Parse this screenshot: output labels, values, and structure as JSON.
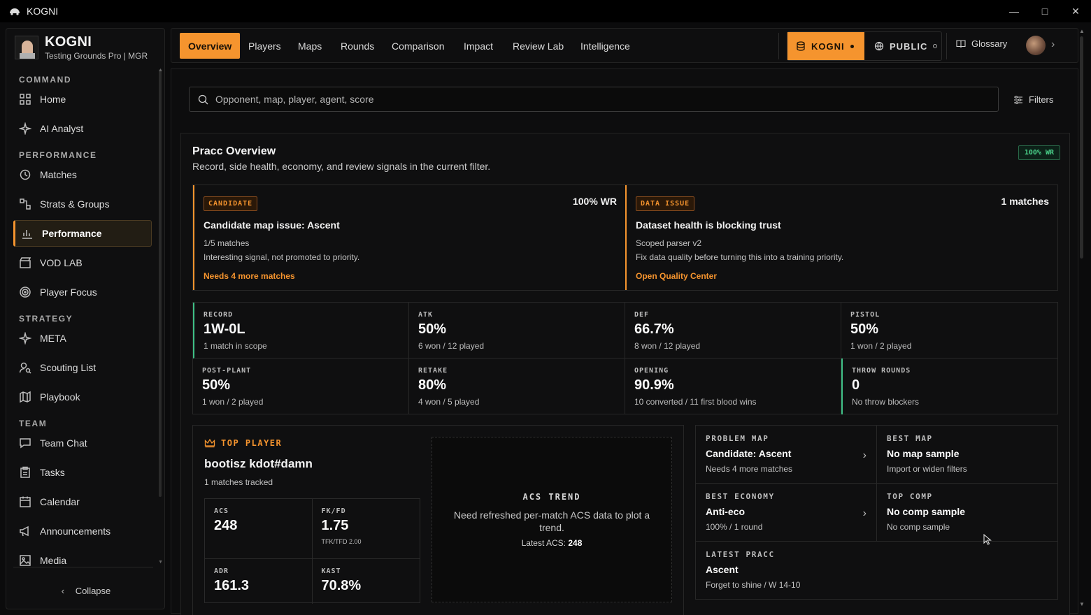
{
  "window": {
    "title": "KOGNI"
  },
  "brand": {
    "name": "KOGNI",
    "subtitle": "Testing Grounds Pro | MGR"
  },
  "sidebar": {
    "sections": [
      "COMMAND",
      "PERFORMANCE",
      "STRATEGY",
      "TEAM"
    ],
    "items": [
      {
        "label": "Home",
        "icon": "grid-icon"
      },
      {
        "label": "AI Analyst",
        "icon": "sparkle-icon"
      },
      {
        "label": "Matches",
        "icon": "history-icon"
      },
      {
        "label": "Strats & Groups",
        "icon": "strats-icon"
      },
      {
        "label": "Performance",
        "icon": "bar-chart-icon"
      },
      {
        "label": "VOD LAB",
        "icon": "clapper-icon"
      },
      {
        "label": "Player Focus",
        "icon": "target-icon"
      },
      {
        "label": "META",
        "icon": "sparkle-icon"
      },
      {
        "label": "Scouting List",
        "icon": "user-search-icon"
      },
      {
        "label": "Playbook",
        "icon": "map-icon"
      },
      {
        "label": "Team Chat",
        "icon": "chat-icon"
      },
      {
        "label": "Tasks",
        "icon": "clipboard-icon"
      },
      {
        "label": "Calendar",
        "icon": "calendar-icon"
      },
      {
        "label": "Announcements",
        "icon": "megaphone-icon"
      },
      {
        "label": "Media",
        "icon": "image-icon"
      }
    ],
    "active": "Performance",
    "collapse_label": "Collapse"
  },
  "topnav": {
    "tabs": [
      "Overview",
      "Players",
      "Maps",
      "Rounds",
      "Comparison",
      "Impact",
      "Review Lab",
      "Intelligence"
    ],
    "active": "Overview",
    "team_kogni": "KOGNI",
    "team_public": "PUBLIC",
    "glossary": "Glossary"
  },
  "search": {
    "placeholder": "Opponent, map, player, agent, score",
    "filters_label": "Filters"
  },
  "overview": {
    "title": "Pracc Overview",
    "subtitle": "Record, side health, economy, and review signals in the current filter.",
    "badge": "100% WR",
    "signals": [
      {
        "tag": "CANDIDATE",
        "right": "100% WR",
        "title": "Candidate map issue: Ascent",
        "line1": "1/5 matches",
        "line2": "Interesting signal, not promoted to priority.",
        "link": "Needs 4 more matches"
      },
      {
        "tag": "DATA ISSUE",
        "right": "1 matches",
        "title": "Dataset health is blocking trust",
        "line1": "Scoped parser v2",
        "line2": "Fix data quality before turning this into a training priority.",
        "link": "Open Quality Center"
      }
    ],
    "stats": [
      {
        "label": "RECORD",
        "value": "1W-0L",
        "note": "1 match in scope"
      },
      {
        "label": "ATK",
        "value": "50%",
        "note": "6 won / 12 played"
      },
      {
        "label": "DEF",
        "value": "66.7%",
        "note": "8 won / 12 played"
      },
      {
        "label": "PISTOL",
        "value": "50%",
        "note": "1 won / 2 played"
      },
      {
        "label": "POST-PLANT",
        "value": "50%",
        "note": "1 won / 2 played"
      },
      {
        "label": "RETAKE",
        "value": "80%",
        "note": "4 won / 5 played"
      },
      {
        "label": "OPENING",
        "value": "90.9%",
        "note": "10 converted / 11 first blood wins"
      },
      {
        "label": "THROW ROUNDS",
        "value": "0",
        "note": "No throw blockers"
      }
    ]
  },
  "top_player": {
    "heading": "TOP PLAYER",
    "name": "bootisz kdot#damn",
    "tracked": "1 matches tracked",
    "stats": [
      {
        "label": "ACS",
        "value": "248",
        "note": ""
      },
      {
        "label": "FK/FD",
        "value": "1.75",
        "note": "TFK/TFD 2.00"
      },
      {
        "label": "ADR",
        "value": "161.3",
        "note": ""
      },
      {
        "label": "KAST",
        "value": "70.8%",
        "note": ""
      }
    ],
    "acs_trend": {
      "heading": "ACS TREND",
      "desc": "Need refreshed per-match ACS data to plot a trend.",
      "latest_label": "Latest ACS:",
      "latest_value": "248"
    }
  },
  "insights": [
    {
      "label": "PROBLEM MAP",
      "value": "Candidate: Ascent",
      "note": "Needs 4 more matches",
      "chevron": true
    },
    {
      "label": "BEST MAP",
      "value": "No map sample",
      "note": "Import or widen filters",
      "chevron": false
    },
    {
      "label": "BEST ECONOMY",
      "value": "Anti-eco",
      "note": "100% / 1 round",
      "chevron": true
    },
    {
      "label": "TOP COMP",
      "value": "No comp sample",
      "note": "No comp sample",
      "chevron": false
    },
    {
      "label": "LATEST PRACC",
      "value": "Ascent",
      "note": "Forget to shine / W 14-10",
      "chevron": false
    }
  ]
}
